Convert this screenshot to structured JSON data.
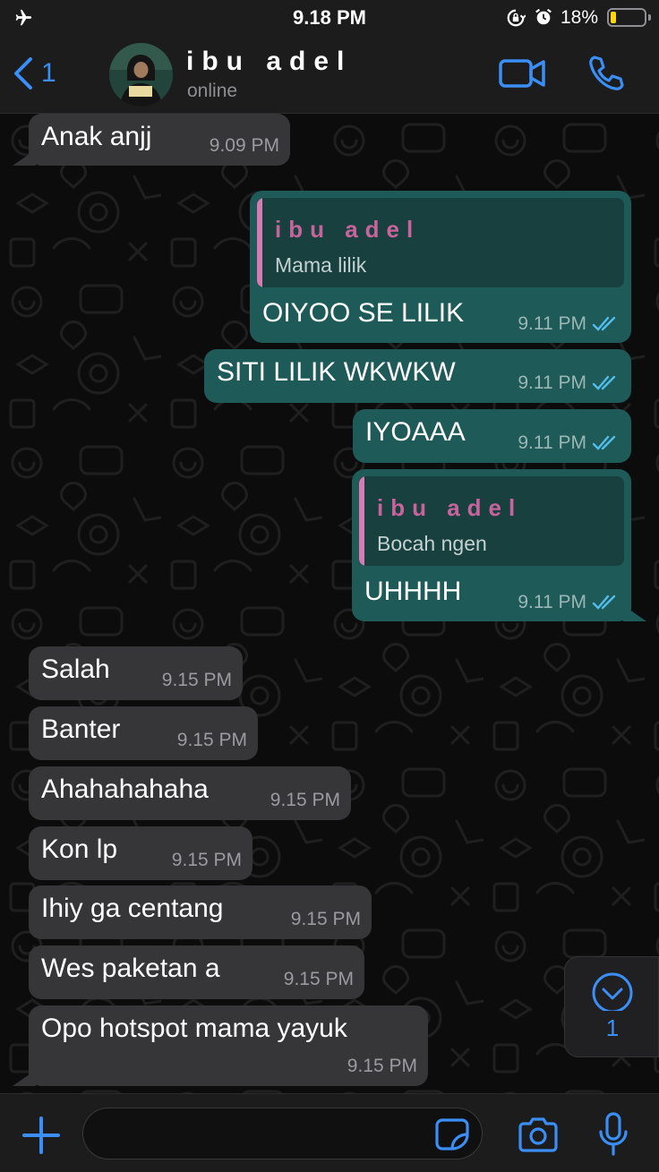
{
  "status_bar": {
    "time": "9.18 PM",
    "battery_percent": "18%",
    "battery_level": 0.18
  },
  "header": {
    "back_count": "1",
    "contact_name": "ibu adel",
    "contact_status": "online"
  },
  "messages": [
    {
      "dir": "in",
      "text": "Anak anjj",
      "time": "9.09 PM"
    },
    {
      "dir": "out",
      "quote_name": "ibu adel",
      "quote_text": "Mama lilik",
      "text": "OIYOO SE LILIK",
      "time": "9.11 PM",
      "read": true
    },
    {
      "dir": "out",
      "text": "SITI LILIK WKWKW",
      "time": "9.11 PM",
      "read": true
    },
    {
      "dir": "out",
      "text": "IYOAAA",
      "time": "9.11 PM",
      "read": true
    },
    {
      "dir": "out",
      "quote_name": "ibu adel",
      "quote_text": "Bocah ngen",
      "text": "UHHHH",
      "time": "9.11 PM",
      "read": true
    },
    {
      "dir": "in",
      "text": "Salah",
      "time": "9.15 PM"
    },
    {
      "dir": "in",
      "text": "Banter",
      "time": "9.15 PM"
    },
    {
      "dir": "in",
      "text": "Ahahahahaha",
      "time": "9.15 PM"
    },
    {
      "dir": "in",
      "text": "Kon lp",
      "time": "9.15 PM"
    },
    {
      "dir": "in",
      "text": "Ihiy ga centang",
      "time": "9.15 PM"
    },
    {
      "dir": "in",
      "text": "Wes paketan a",
      "time": "9.15 PM"
    },
    {
      "dir": "in",
      "text": "Opo hotspot mama yayuk",
      "time": "9.15 PM"
    }
  ],
  "scroll_down": {
    "unread_count": "1"
  },
  "input": {
    "value": "",
    "placeholder": ""
  },
  "colors": {
    "accent": "#3a8ef5",
    "incoming_bubble": "#363638",
    "outgoing_bubble": "#1e5a58",
    "quote_name": "#c8649c",
    "read_ticks": "#53bdeb",
    "battery": "#ffd60a"
  },
  "icons": [
    "airplane-icon",
    "orientation-lock-icon",
    "alarm-icon",
    "battery-icon",
    "chevron-left-icon",
    "video-camera-icon",
    "phone-icon",
    "double-check-icon",
    "chevron-down-icon",
    "plus-icon",
    "sticker-icon",
    "camera-icon",
    "microphone-icon"
  ]
}
